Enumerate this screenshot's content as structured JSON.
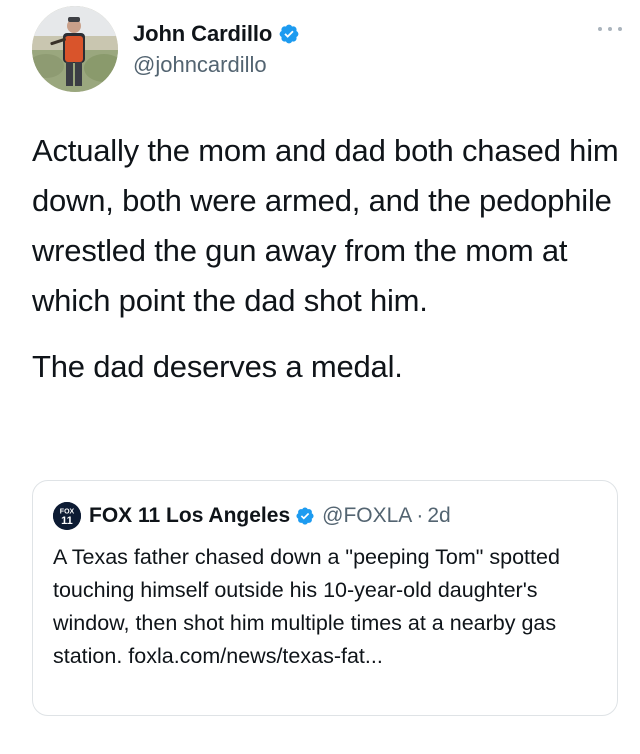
{
  "tweet": {
    "author": {
      "display_name": "John Cardillo",
      "handle": "@johncardillo",
      "verified_icon": "verified-badge-icon",
      "avatar": "profile-photo"
    },
    "more_icon": "more-options-icon",
    "paragraphs": [
      "Actually the mom and dad both chased him down, both were armed, and the pedophile wrestled the gun away from the mom at which point the dad shot him.",
      "The dad deserves a medal."
    ],
    "quoted": {
      "avatar_label_top": "FOX",
      "avatar_label_bottom": "11",
      "display_name": "FOX 11 Los Angeles",
      "handle": "@FOXLA",
      "separator": "·",
      "time": "2d",
      "text": "A Texas father chased down a \"peeping Tom\" spotted touching himself outside his 10-year-old daughter's window, then shot him multiple times at a nearby gas station.  foxla.com/news/texas-fat..."
    }
  },
  "colors": {
    "text": "#0f1419",
    "secondary": "#536471",
    "verified": "#1d9bf0",
    "border": "#dfe3e6"
  }
}
